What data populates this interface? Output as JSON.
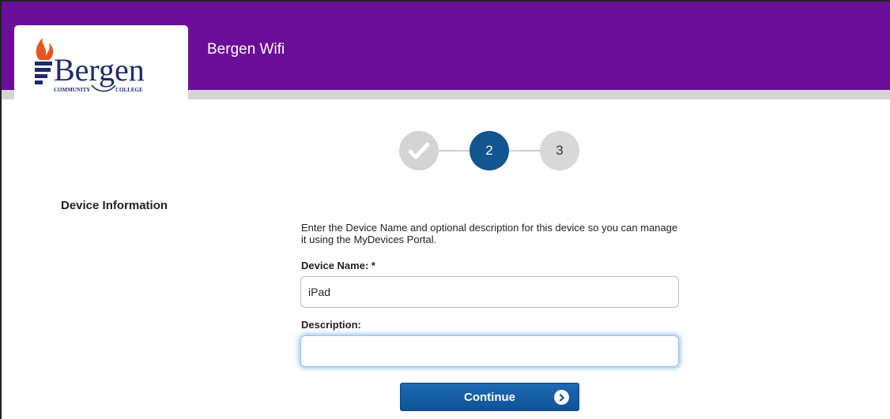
{
  "header": {
    "title": "Bergen Wifi",
    "bg_color": "#6a0e9a",
    "logo": {
      "wordmark": "Bergen",
      "tagline_left": "COMMUNITY",
      "tagline_right": "COLLEGE"
    }
  },
  "steps": [
    {
      "label": "",
      "state": "completed",
      "icon": "check-icon"
    },
    {
      "label": "2",
      "state": "active"
    },
    {
      "label": "3",
      "state": "pending"
    }
  ],
  "section": {
    "title": "Device Information",
    "intro": "Enter the Device Name and optional description for this device so you can manage it using the MyDevices Portal."
  },
  "form": {
    "device_name_label": "Device Name: *",
    "device_name_value": "iPad",
    "description_label": "Description:",
    "description_value": "",
    "continue_label": "Continue",
    "accent_color": "#12558f"
  }
}
